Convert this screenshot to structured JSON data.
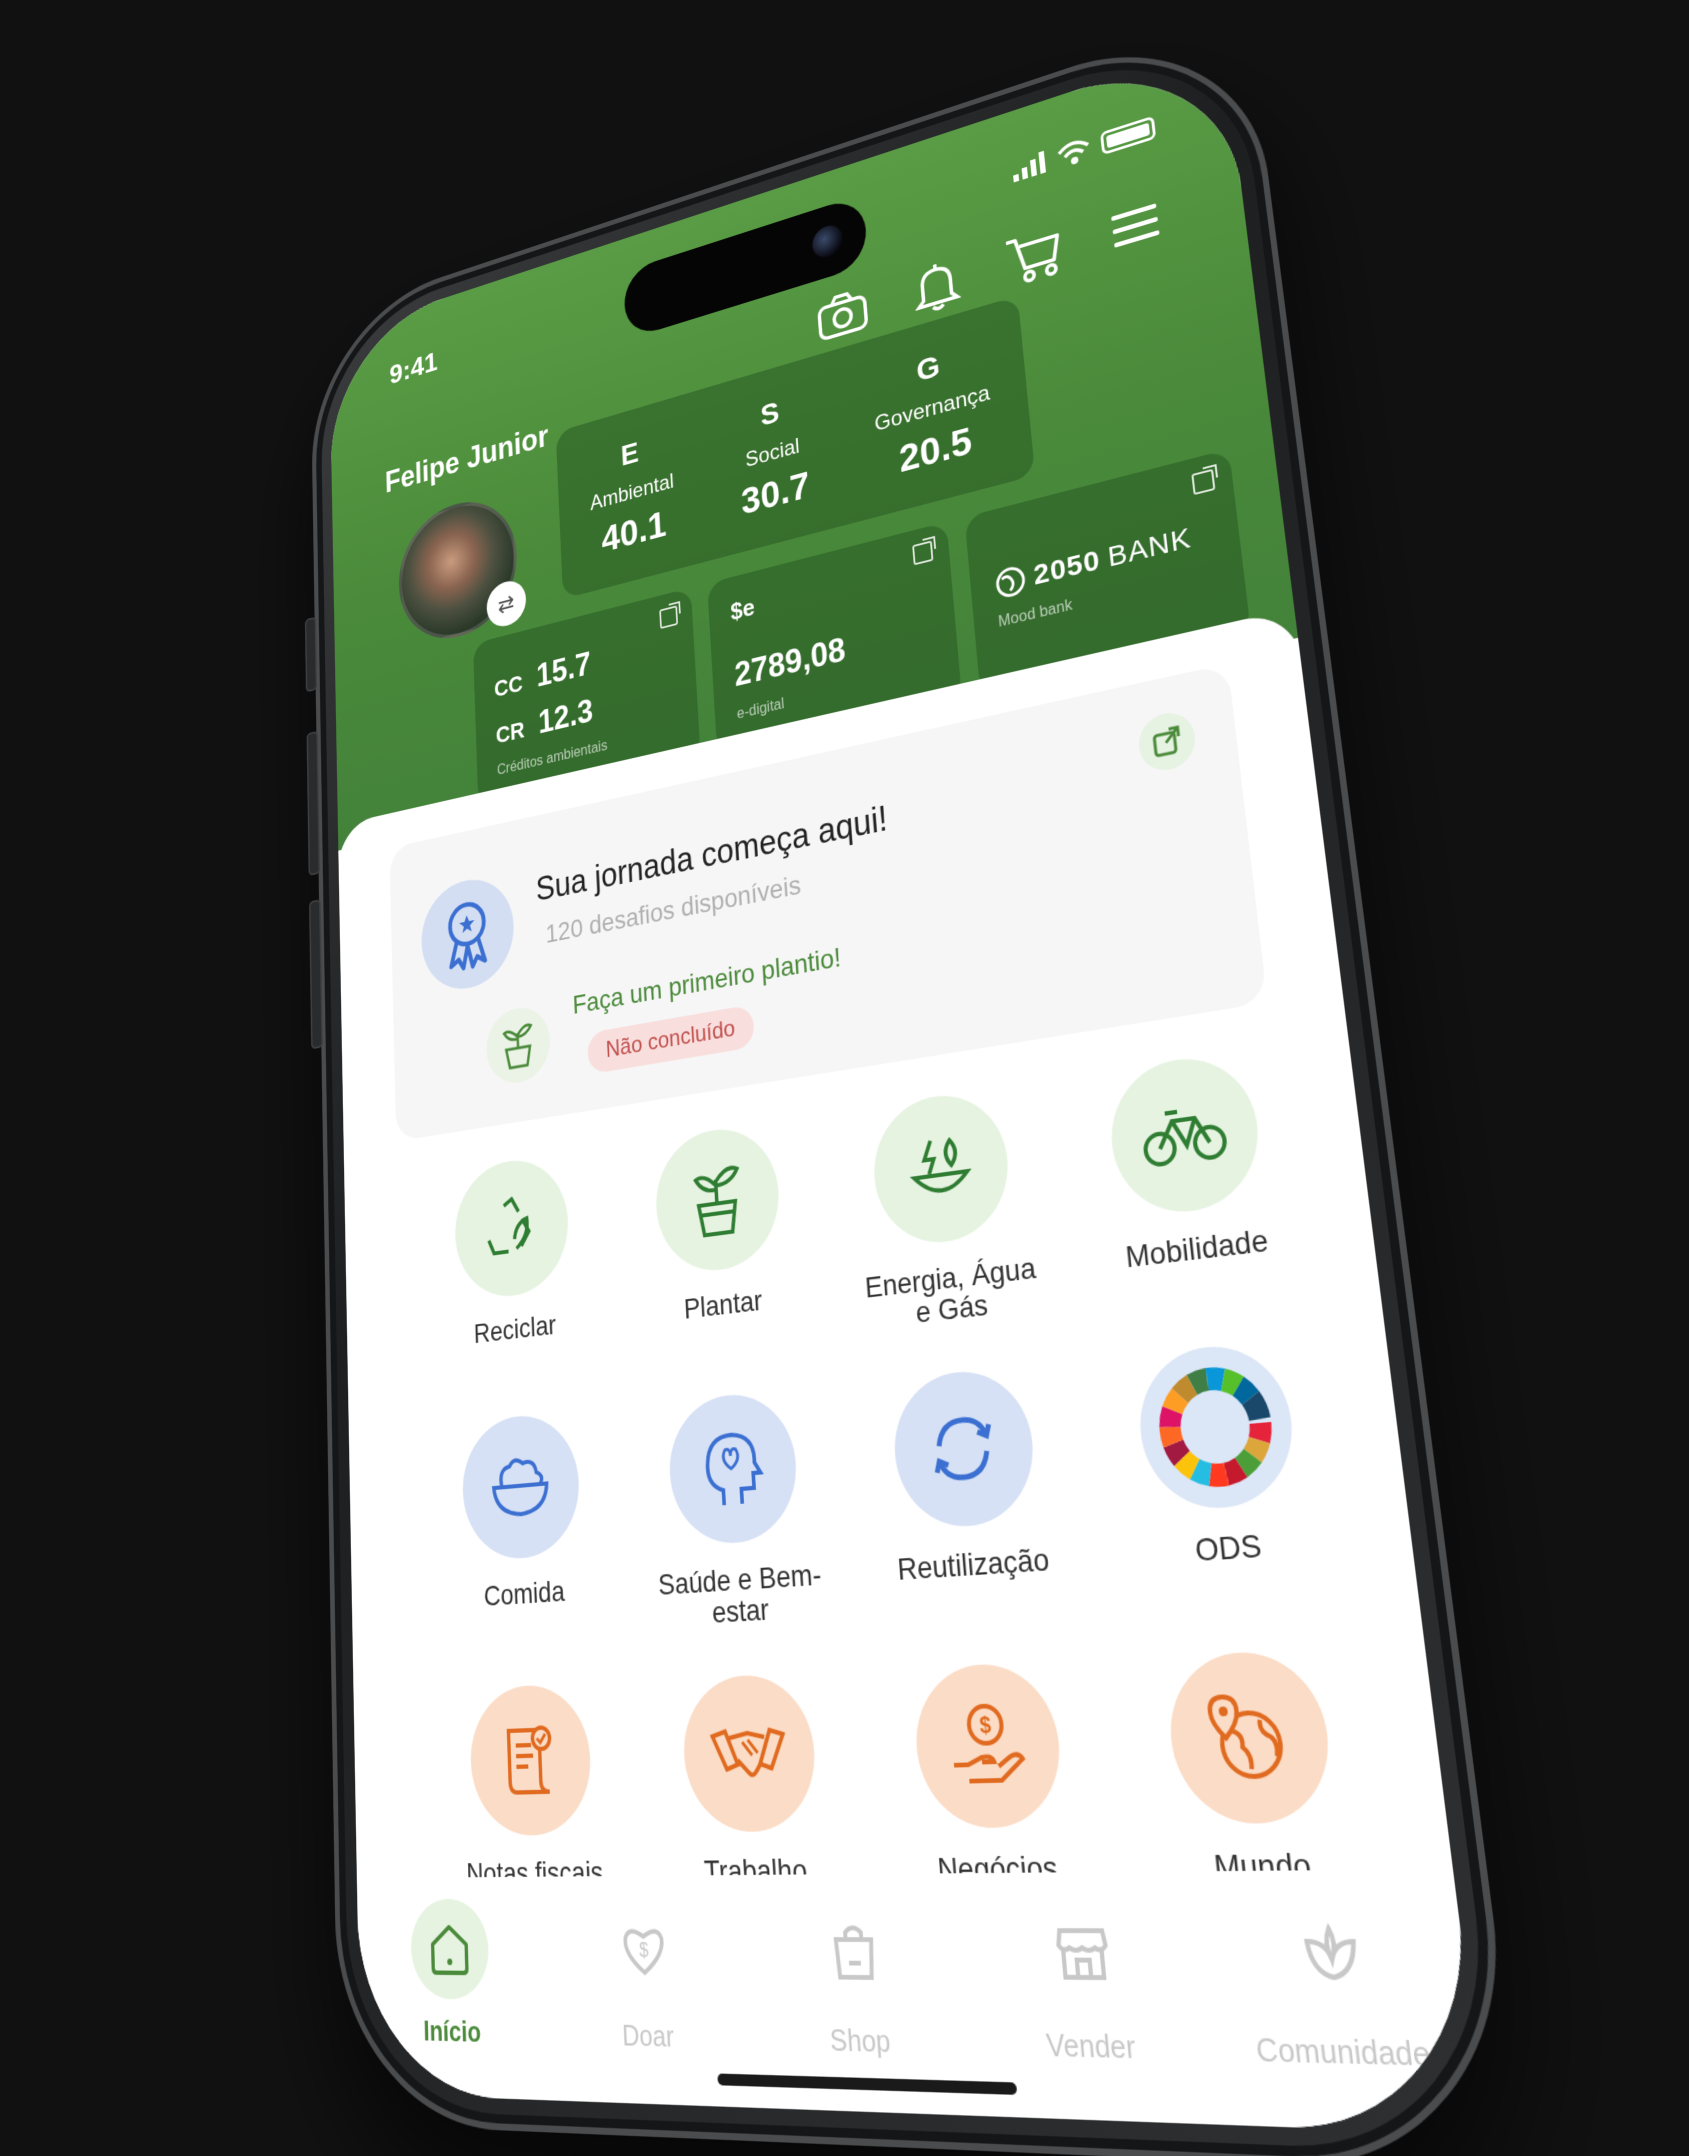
{
  "status": {
    "time": "9:41"
  },
  "user": {
    "name": "Felipe Junior"
  },
  "esg": [
    {
      "letter": "E",
      "name": "Ambiental",
      "score": "40.1"
    },
    {
      "letter": "S",
      "name": "Social",
      "score": "30.7"
    },
    {
      "letter": "G",
      "name": "Governança",
      "score": "20.5"
    }
  ],
  "credits": {
    "cc_label": "CC",
    "cc_value": "15.7",
    "cr_label": "CR",
    "cr_value": "12.3",
    "caption": "Créditos ambientais"
  },
  "digital": {
    "label": "$e",
    "value": "2789,08",
    "caption": "e-digital"
  },
  "bank": {
    "logo_bold": "2050",
    "logo_thin": "BANK",
    "caption": "Mood bank"
  },
  "journey": {
    "title": "Sua jornada começa aqui!",
    "subtitle": "120 desafios disponíveis",
    "task_title": "Faça um primeiro plantio!",
    "task_status": "Não concluído"
  },
  "categories": [
    {
      "label": "Reciclar",
      "icon": "recycle-icon"
    },
    {
      "label": "Plantar",
      "icon": "plant-icon"
    },
    {
      "label": "Energia, Água e Gás",
      "icon": "energy-icon"
    },
    {
      "label": "Mobilidade",
      "icon": "bike-icon"
    },
    {
      "label": "Comida",
      "icon": "food-icon"
    },
    {
      "label": "Saúde e Bem-estar",
      "icon": "health-icon"
    },
    {
      "label": "Reutilização",
      "icon": "reuse-icon"
    },
    {
      "label": "ODS",
      "icon": "ods-icon"
    },
    {
      "label": "Notas fiscais",
      "icon": "receipt-icon"
    },
    {
      "label": "Trabalho",
      "icon": "handshake-icon"
    },
    {
      "label": "Negócios",
      "icon": "business-icon"
    },
    {
      "label": "Mundo",
      "icon": "world-icon"
    }
  ],
  "tabs": [
    {
      "label": "Início",
      "icon": "home-icon"
    },
    {
      "label": "Doar",
      "icon": "donate-icon"
    },
    {
      "label": "Shop",
      "icon": "bag-icon"
    },
    {
      "label": "Vender",
      "icon": "store-icon"
    },
    {
      "label": "Comunidade",
      "icon": "community-icon"
    }
  ],
  "colors": {
    "primary_green": "#4a8a3a",
    "blue_tile": "#d6e1f5",
    "orange_tile": "#fbdcc6",
    "green_tile": "#e6f3e1",
    "status_red": "#c0504d"
  }
}
